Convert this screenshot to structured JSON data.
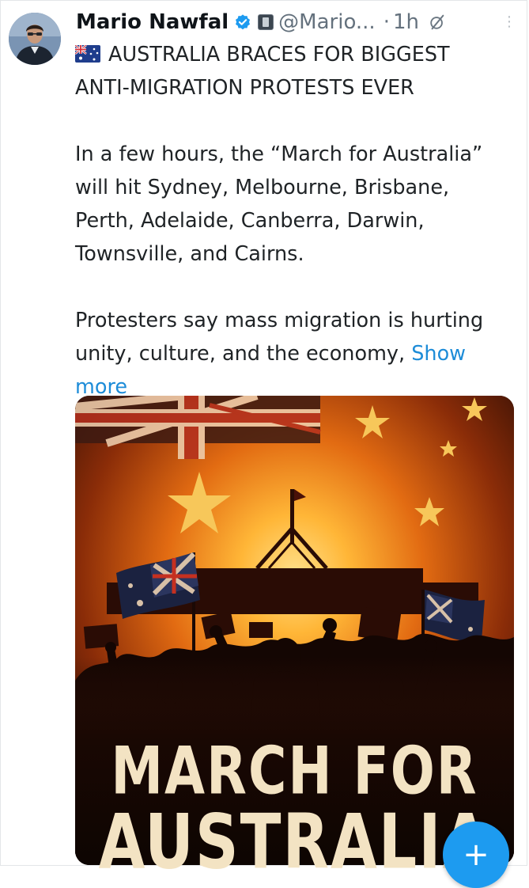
{
  "tweet": {
    "author_name": "Mario Nawfal",
    "handle": "@Mario...",
    "separator": "·",
    "timestamp": "1h",
    "headline_line1": "AUSTRALIA BRACES FOR BIGGEST",
    "headline_line2": "ANTI-MIGRATION PROTESTS EVER",
    "paragraph1_lines": [
      "In a few hours, the “March for Australia”",
      "will hit Sydney, Melbourne, Brisbane,",
      "Perth, Adelaide, Canberra, Darwin,",
      "Townsville, and Cairns."
    ],
    "paragraph2_line1": "Protesters say mass migration is hurting",
    "paragraph2_line2": "unity, culture, and the economy,",
    "show_more_part1": "Show",
    "show_more_part2": "more"
  },
  "media": {
    "poster_line1": "MARCH FOR",
    "poster_line2": "AUSTRALIA"
  },
  "compose_button": {
    "label": "+"
  },
  "icons": {
    "verified": "verified-badge-icon",
    "affiliate": "affiliate-badge-icon",
    "grok": "grok-icon",
    "more": "more-options-icon",
    "flag": "australia-flag-emoji"
  },
  "colors": {
    "link_blue": "#1d8cd8",
    "verified_blue": "#1d9bf0",
    "muted_gray": "#64717d"
  }
}
